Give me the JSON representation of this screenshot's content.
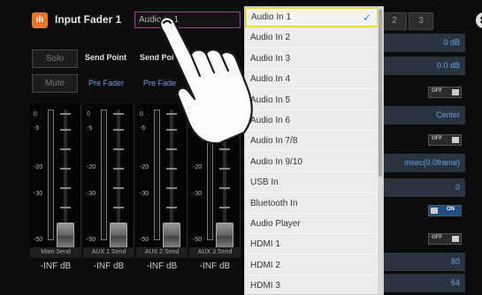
{
  "title_bar": {
    "icon_glyph": "ılı",
    "title": "Input Fader 1",
    "name_value": "Audio In 1"
  },
  "channel": {
    "solo_label": "Solo",
    "mute_label": "Mute",
    "sends": [
      {
        "title": "Send Point",
        "value": "Pre Fader"
      },
      {
        "title": "Send Poi",
        "value": "Pre Fade"
      }
    ]
  },
  "faders": [
    {
      "label": "Main Send",
      "value": "-INF dB",
      "scale": [
        "0",
        "-5",
        "-20",
        "-30",
        "-50"
      ]
    },
    {
      "label": "AUX 1 Send",
      "value": "-INF dB",
      "scale": [
        "0",
        "-5",
        "-20",
        "-30",
        "-50"
      ]
    },
    {
      "label": "AUX 2 Send",
      "value": "-INF dB",
      "scale": [
        "0",
        "-5",
        "-20",
        "-30",
        "-50"
      ]
    },
    {
      "label": "AUX 3 Send",
      "value": "-INF dB",
      "scale": [
        "0",
        "-5",
        "-20",
        "-30",
        "-50"
      ]
    }
  ],
  "dropdown": {
    "selected": "Audio In 1",
    "options": [
      "Audio In 1",
      "Audio In 2",
      "Audio In 3",
      "Audio In 4",
      "Audio In 5",
      "Audio In 6",
      "Audio In 7/8",
      "Audio In 9/10",
      "USB In",
      "Bluetooth In",
      "Audio Player",
      "HDMI 1",
      "HDMI 2",
      "HDMI 3"
    ],
    "check_icon": "check-icon"
  },
  "right_panel": {
    "tabs": [
      "2",
      "3"
    ],
    "close_glyph": "✖",
    "params": [
      {
        "value": "0 dB"
      },
      {
        "value": "0.0 dB"
      },
      {
        "toggle": "OFF",
        "state": "off"
      },
      {
        "value": "Center"
      },
      {
        "toggle": "OFF",
        "state": "off"
      },
      {
        "value": "msec(0.0frame)"
      },
      {
        "value": "0"
      },
      {
        "toggle": "ON",
        "state": "on"
      },
      {
        "toggle": "OFF",
        "state": "off"
      },
      {
        "value": "80"
      },
      {
        "value": "64"
      }
    ]
  },
  "colors": {
    "accent_orange": "#e8742a",
    "accent_blue": "#6aa0e8",
    "selection_yellow": "#e5dc3c",
    "name_border": "#b02fb8"
  }
}
